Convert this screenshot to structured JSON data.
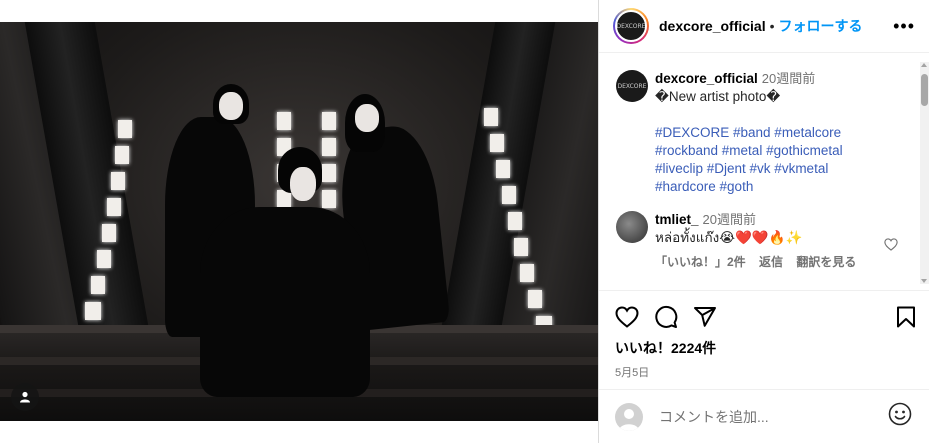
{
  "post": {
    "username": "dexcore_official",
    "follow_label": "フォローする",
    "separator": "•",
    "more_label": "•••",
    "avatar_text": "DEXCORE"
  },
  "caption": {
    "username": "dexcore_official",
    "time": "20週間前",
    "text": "�New artist photo�",
    "hashtags_line1": "#DEXCORE #band #metalcore",
    "hashtags_line2": "#rockband #metal #gothicmetal",
    "hashtags_line3": "#liveclip #Djent #vk #vkmetal",
    "hashtags_line4": "#hardcore #goth"
  },
  "comment": {
    "username": "tmliet_",
    "time": "20週間前",
    "text": "หล่อทั้งแก๊ง😭❤️❤️🔥✨",
    "likes_label": "「いいね！」2件",
    "reply_label": "返信",
    "translate_label": "翻訳を見る"
  },
  "actions": {
    "likes": "いいね！2224件",
    "date": "5月5日"
  },
  "add_comment": {
    "placeholder": "コメントを追加..."
  },
  "colors": {
    "accent": "#0095f6",
    "hashtag": "#3a5db8",
    "muted": "#737373",
    "border": "#dbdbdb"
  },
  "icons": [
    "more-options-icon",
    "heart-icon",
    "comment-icon",
    "share-icon",
    "bookmark-icon",
    "emoji-icon",
    "user-tag-icon"
  ]
}
